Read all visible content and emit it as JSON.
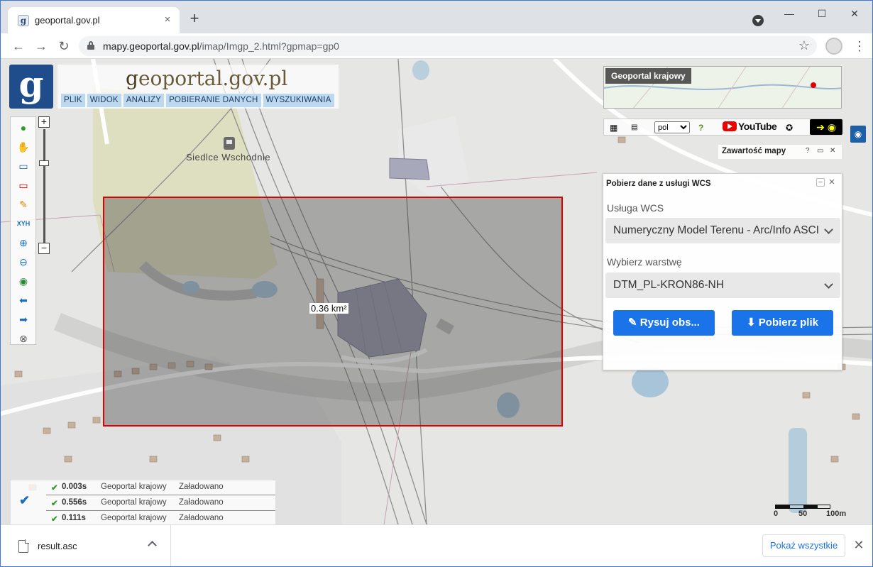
{
  "browser": {
    "tab_title": "geoportal.gov.pl",
    "tab_favicon": "geoportal-favicon",
    "url_host": "mapy.geoportal.gov.pl",
    "url_path": "/imap/Imgp_2.html?gpmap=gp0",
    "new_tab": "+",
    "close": "×",
    "minimize": "—",
    "maximize": "☐",
    "win_close": "✕"
  },
  "app": {
    "logo_letter": "g",
    "title_prefix": "g",
    "title_rest": "eoportal.gov.pl",
    "menu": [
      "PLIK",
      "WIDOK",
      "ANALIZY",
      "POBIERANIE DANYCH",
      "WYSZUKIWANIA"
    ]
  },
  "map": {
    "place_label": "Siedlce Wschodnie",
    "area_label": "0.36 km²",
    "minimap_title": "Geoportal krajowy",
    "language": "pol",
    "youtube": "YouTube",
    "contents_title": "Zawartość mapy",
    "scale_labels": [
      "0",
      "50",
      "100m"
    ]
  },
  "wcs_panel": {
    "title": "Pobierz dane z usługi WCS",
    "service_label": "Usługa WCS",
    "service_value": "Numeryczny Model Terenu - Arc/Info ASCII Grid",
    "layer_label": "Wybierz warstwę",
    "layer_value": "DTM_PL-KRON86-NH",
    "draw_button": "Rysuj obs...",
    "download_button": "Pobierz plik"
  },
  "status_log": [
    {
      "time": "0.003s",
      "source": "Geoportal krajowy",
      "status": "Załadowano"
    },
    {
      "time": "0.556s",
      "source": "Geoportal krajowy",
      "status": "Załadowano"
    },
    {
      "time": "0.111s",
      "source": "Geoportal krajowy",
      "status": "Załadowano"
    }
  ],
  "downloads": {
    "file_name": "result.asc",
    "show_all": "Pokaż wszystkie"
  },
  "colors": {
    "selection": "#e00000",
    "button_primary": "#1a73e8",
    "menu_bg": "#bcd9ef",
    "logo_bg": "#1f4d8b"
  }
}
